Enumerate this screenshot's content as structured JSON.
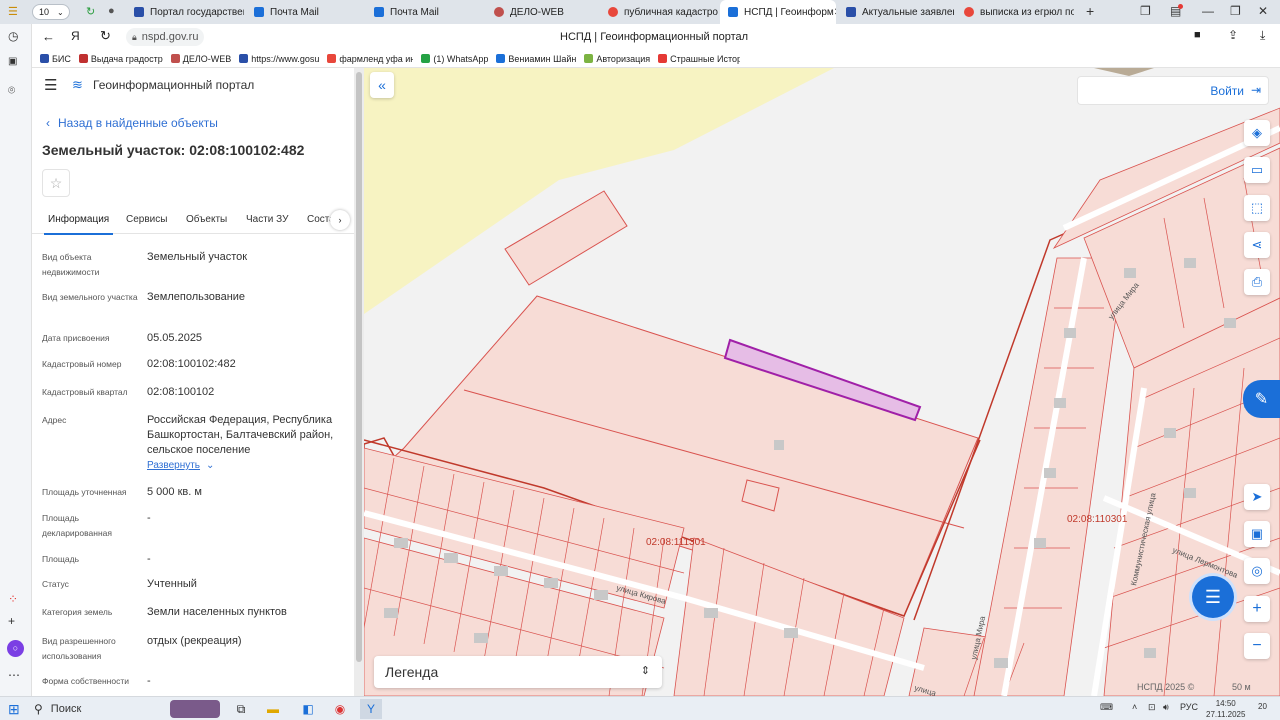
{
  "browser": {
    "tabs_count": "10",
    "tabs": [
      {
        "title": "Портал государственн",
        "color": "#2a4fa8"
      },
      {
        "title": "Почта Mail",
        "color": "#1b6fd8"
      },
      {
        "title": "Почта Mail",
        "color": "#1b6fd8"
      },
      {
        "title": "ДЕЛО-WEB",
        "color": "#c0504d"
      },
      {
        "title": "публичная кадастров",
        "color": "#e8473b"
      },
      {
        "title": "НСПД | Геоинформ",
        "color": "#1b6fd8"
      },
      {
        "title": "Актуальные заявлени",
        "color": "#2a4fa8"
      },
      {
        "title": "выписка из егрюл по",
        "color": "#e8473b"
      }
    ],
    "close_glyph": "✕",
    "new_tab": "+",
    "url": "nspd.gov.ru",
    "window_title": "НСПД | Геоинформационный портал",
    "bookmarks": [
      {
        "label": "БИС",
        "color": "#2a4fa8"
      },
      {
        "label": "Выдача градостр",
        "color": "#c03030"
      },
      {
        "label": "ДЕЛО-WEB",
        "color": "#c0504d"
      },
      {
        "label": "https://www.gosu",
        "color": "#2a4fa8"
      },
      {
        "label": "фармленд уфа ин",
        "color": "#e8473b"
      },
      {
        "label": "(1) WhatsApp",
        "color": "#25a244"
      },
      {
        "label": "Вениамин Шайн",
        "color": "#1b6fd8"
      },
      {
        "label": "Авторизация",
        "color": "#7cb342"
      },
      {
        "label": "Страшные Истор",
        "color": "#e53935"
      }
    ]
  },
  "portal": {
    "title": "Геоинформационный портал",
    "back_link": "Назад в найденные объекты",
    "object_title": "Земельный участок: 02:08:100102:482",
    "tabs": [
      "Информация",
      "Сервисы",
      "Объекты",
      "Части ЗУ",
      "Соста"
    ],
    "expand_link": "Развернуть",
    "fields": [
      {
        "label": "Вид объекта недвижимости",
        "value": "Земельный участок"
      },
      {
        "label": "Вид земельного участка",
        "value": "Землепользование"
      },
      {
        "label": "Дата присвоения",
        "value": "05.05.2025"
      },
      {
        "label": "Кадастровый номер",
        "value": "02:08:100102:482"
      },
      {
        "label": "Кадастровый квартал",
        "value": "02:08:100102"
      },
      {
        "label": "Адрес",
        "value": "Российская Федерация, Республика Башкортостан, Балтачевский район, сельское поселение"
      },
      {
        "label": "Площадь уточненная",
        "value": "5 000 кв. м"
      },
      {
        "label": "Площадь декларированная",
        "value": "-"
      },
      {
        "label": "Площадь",
        "value": "-"
      },
      {
        "label": "Статус",
        "value": "Учтенный"
      },
      {
        "label": "Категория земель",
        "value": "Земли населенных пунктов"
      },
      {
        "label": "Вид разрешенного использования",
        "value": "отдых (рекреация)"
      },
      {
        "label": "Форма собственности",
        "value": "-"
      }
    ]
  },
  "map": {
    "login": "Войти",
    "legend": "Легенда",
    "copyright": "НСПД 2025 ©",
    "scale": "50 м",
    "labels": {
      "quarter1": "02:08:111301",
      "quarter2": "02:08:110301",
      "street_kirova": "улица Кирова",
      "street_mira": "улица Мира",
      "street_mira2": "улица Мира",
      "street_komm": "Коммунистическая улица",
      "street_lerm": "улица Лермонтова",
      "street_bottom": "улица"
    },
    "colors": {
      "parcel_line": "#d9534f",
      "parcel_fill": "#f7dcd6",
      "selected": "#a020a8",
      "yellow_zone": "#f7f3c2"
    }
  },
  "taskbar": {
    "search": "Поиск",
    "lang": "РУС",
    "time": "14:50",
    "date": "27.11.2025",
    "notif": "20"
  }
}
